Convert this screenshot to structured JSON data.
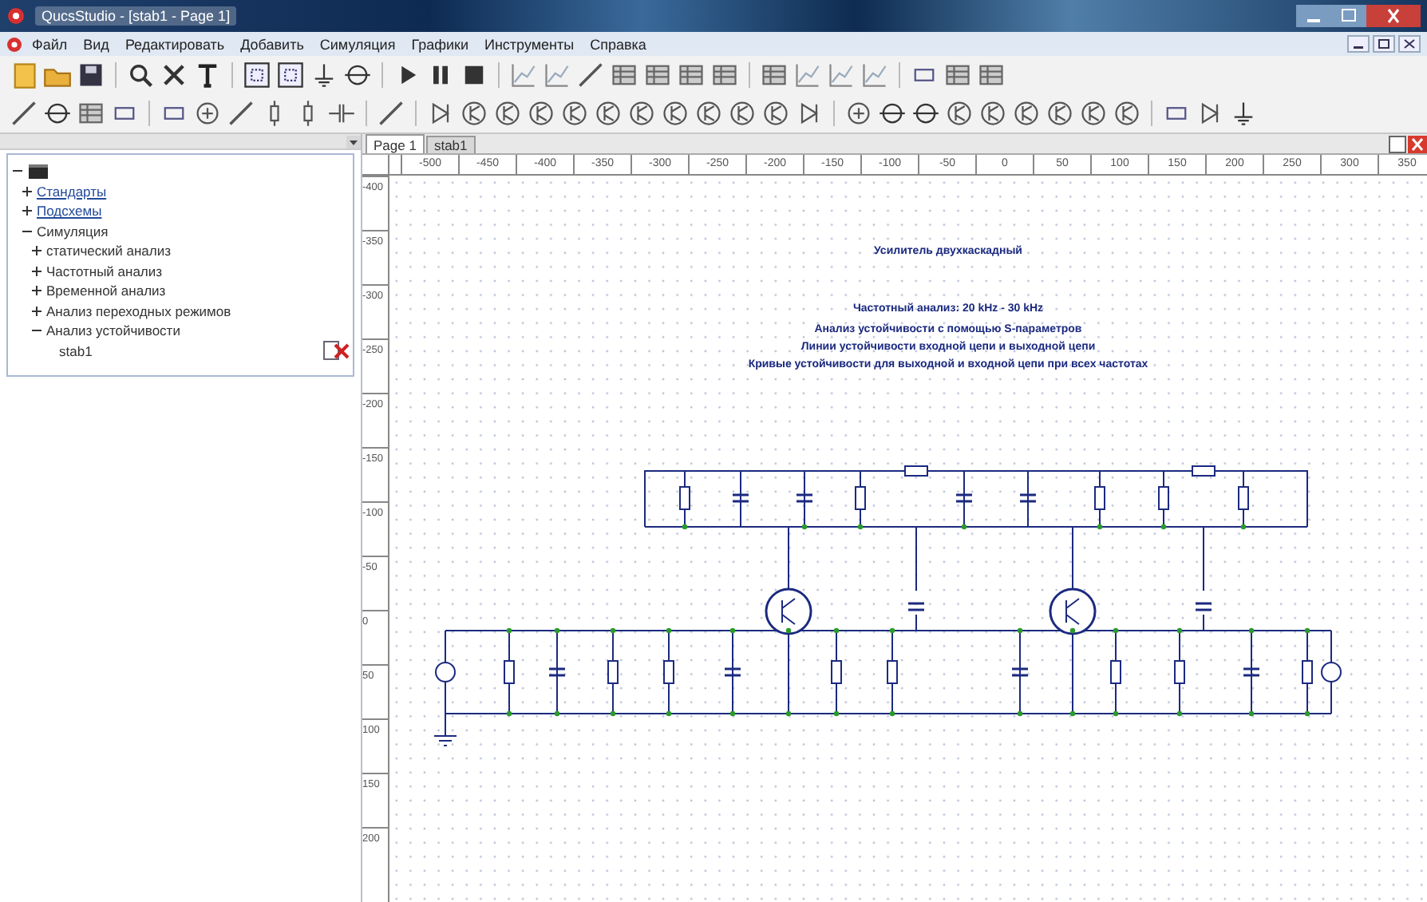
{
  "window": {
    "title": "QucsStudio - [stab1 - Page 1]"
  },
  "menu": [
    "Файл",
    "Вид",
    "Редактировать",
    "Добавить",
    "Симуляция",
    "Графики",
    "Инструменты",
    "Справка"
  ],
  "tree": {
    "expanded": true,
    "children": [
      {
        "label": "Стандарты",
        "expanded": false,
        "link": true
      },
      {
        "label": "Подсхемы",
        "expanded": false,
        "link": true
      },
      {
        "label": "Симуляция",
        "expanded": true,
        "children": [
          {
            "label": "статический анализ",
            "expanded": false
          },
          {
            "label": "Частотный анализ",
            "expanded": false
          },
          {
            "label": "Временной анализ",
            "expanded": false
          },
          {
            "label": "Анализ переходных режимов",
            "expanded": false
          },
          {
            "label": "Анализ устойчивости",
            "expanded": true,
            "children": [
              {
                "label": "stab1",
                "removable": true
              }
            ]
          }
        ]
      }
    ]
  },
  "tabs": [
    {
      "label": "Page 1",
      "selected": true
    },
    {
      "label": "stab1",
      "selected": false
    }
  ],
  "ruler": {
    "x_ticks": [
      "-500",
      "-450",
      "-400",
      "-350",
      "-300",
      "-250",
      "-200",
      "-150",
      "-100",
      "-50",
      "0",
      "50",
      "100",
      "150",
      "200",
      "250",
      "300",
      "350"
    ],
    "y_ticks": [
      "-400",
      "-350",
      "-300",
      "-250",
      "-200",
      "-150",
      "-100",
      "-50",
      "0",
      "50",
      "100",
      "150",
      "200"
    ]
  },
  "notes": [
    "Усилитель двухкаскадный",
    "Частотный анализ: 20 kHz - 30 kHz",
    "Анализ устойчивости с помощью S-параметров",
    "Линии устойчивости входной цепи и выходной цепи",
    "Кривые устойчивости для выходной и входной цепи при всех частотах"
  ]
}
